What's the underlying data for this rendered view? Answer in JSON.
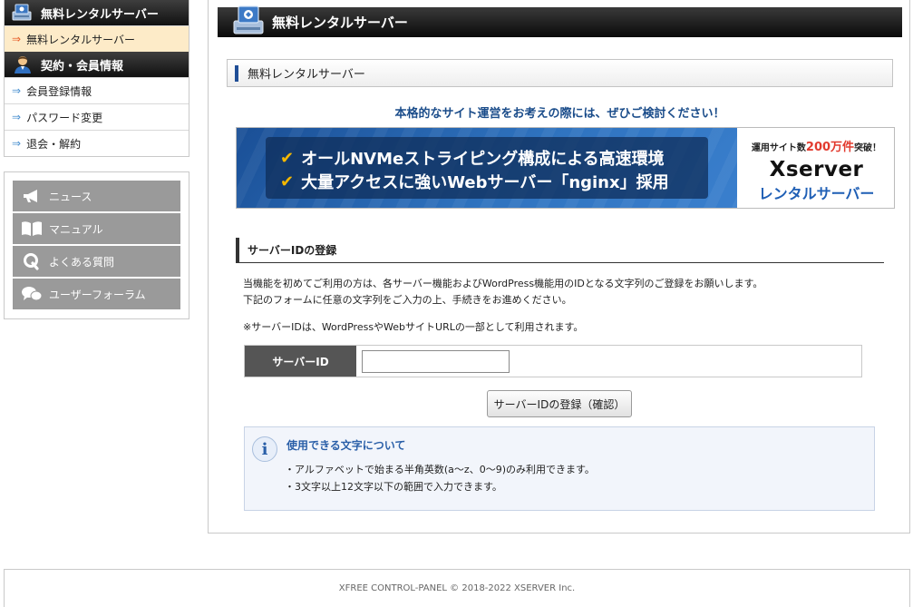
{
  "sidebar": {
    "server_section": {
      "title": "無料レンタルサーバー",
      "icon": "server-icon",
      "items": [
        {
          "label": "無料レンタルサーバー",
          "active": true
        }
      ]
    },
    "account_section": {
      "title": "契約・会員情報",
      "icon": "user-icon",
      "items": [
        {
          "label": "会員登録情報"
        },
        {
          "label": "パスワード変更"
        },
        {
          "label": "退会・解約"
        }
      ]
    },
    "links": [
      {
        "label": "ニュース",
        "icon": "megaphone-icon"
      },
      {
        "label": "マニュアル",
        "icon": "book-icon"
      },
      {
        "label": "よくある質問",
        "icon": "q-icon"
      },
      {
        "label": "ユーザーフォーラム",
        "icon": "chat-icon"
      }
    ]
  },
  "main": {
    "title": "無料レンタルサーバー",
    "section_title": "無料レンタルサーバー",
    "tagline": "本格的なサイト運営をお考えの際には、ぜひご検討ください！",
    "banner": {
      "line1": "オールNVMeストライピング構成による高速環境",
      "line2": "大量アクセスに強いWebサーバー「nginx」採用",
      "badge_prefix": "運用サイト数",
      "badge_number": "200万件",
      "badge_suffix": "突破！",
      "brand": "Xserver",
      "brand_sub": "レンタルサーバー"
    },
    "registration": {
      "heading": "サーバーIDの登録",
      "desc1": "当機能を初めてご利用の方は、各サーバー機能およびWordPress機能用のIDとなる文字列のご登録をお願いします。",
      "desc2": "下記のフォームに任意の文字列をご入力の上、手続きをお進めください。",
      "note": "※サーバーIDは、WordPressやWebサイトURLの一部として利用されます。",
      "field_label": "サーバーID",
      "field_value": "",
      "field_placeholder": "",
      "submit_label": "サーバーIDの登録（確認）"
    },
    "info": {
      "title": "使用できる文字について",
      "line1": "・アルファベットで始まる半角英数(a～z、0～9)のみ利用できます。",
      "line2": "・3文字以上12文字以下の範囲で入力できます。"
    }
  },
  "footer": {
    "copyright": "XFREE CONTROL-PANEL © 2018-2022 XSERVER Inc."
  },
  "colors": {
    "accent_blue": "#1f4e96",
    "active_bg": "#fdebc8",
    "active_arrow": "#e8602c",
    "link_btn_bg": "#9a9a9a"
  }
}
